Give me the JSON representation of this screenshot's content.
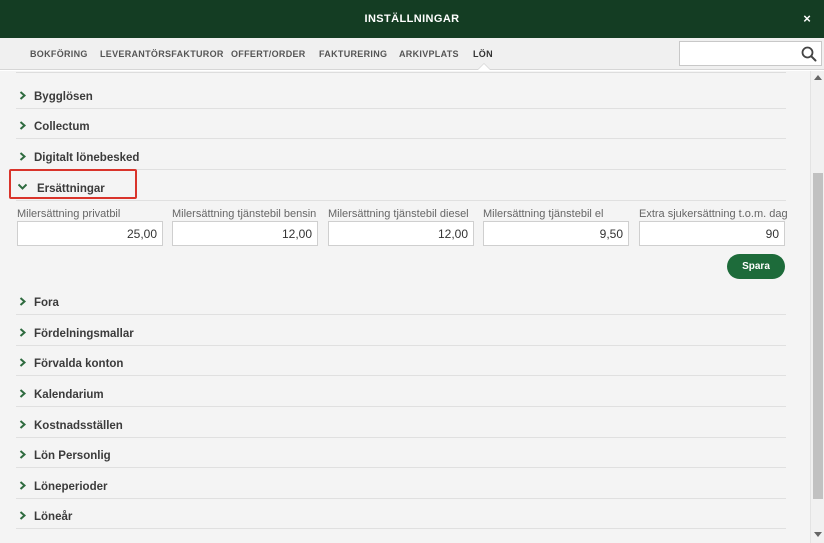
{
  "window": {
    "title": "INSTÄLLNINGAR",
    "close_label": "×"
  },
  "tabs": [
    {
      "label": "BOKFÖRING"
    },
    {
      "label": "LEVERANTÖRSFAKTUROR"
    },
    {
      "label": "OFFERT/ORDER"
    },
    {
      "label": "FAKTURERING"
    },
    {
      "label": "ARKIVPLATS"
    },
    {
      "label": "LÖN",
      "active": true
    }
  ],
  "search": {
    "value": "",
    "placeholder": ""
  },
  "sections_before": [
    {
      "label": "Bygglösen"
    },
    {
      "label": "Collectum"
    },
    {
      "label": "Digitalt lönebesked"
    }
  ],
  "expanded_section": {
    "label": "Ersättningar",
    "fields": [
      {
        "label": "Milersättning privatbil",
        "value": "25,00"
      },
      {
        "label": "Milersättning tjänstebil bensin",
        "value": "12,00"
      },
      {
        "label": "Milersättning tjänstebil diesel",
        "value": "12,00"
      },
      {
        "label": "Milersättning tjänstebil el",
        "value": "9,50"
      },
      {
        "label": "Extra sjukersättning t.o.m. dag",
        "value": "90"
      }
    ],
    "save_label": "Spara"
  },
  "sections_after": [
    {
      "label": "Fora"
    },
    {
      "label": "Fördelningsmallar"
    },
    {
      "label": "Förvalda konton"
    },
    {
      "label": "Kalendarium"
    },
    {
      "label": "Kostnadsställen"
    },
    {
      "label": "Lön Personlig"
    },
    {
      "label": "Löneperioder"
    },
    {
      "label": "Löneår"
    }
  ],
  "colors": {
    "header": "#143d23",
    "accent": "#1d6b3a",
    "highlight": "#d9342b",
    "chevron": "#2e6b3f"
  }
}
